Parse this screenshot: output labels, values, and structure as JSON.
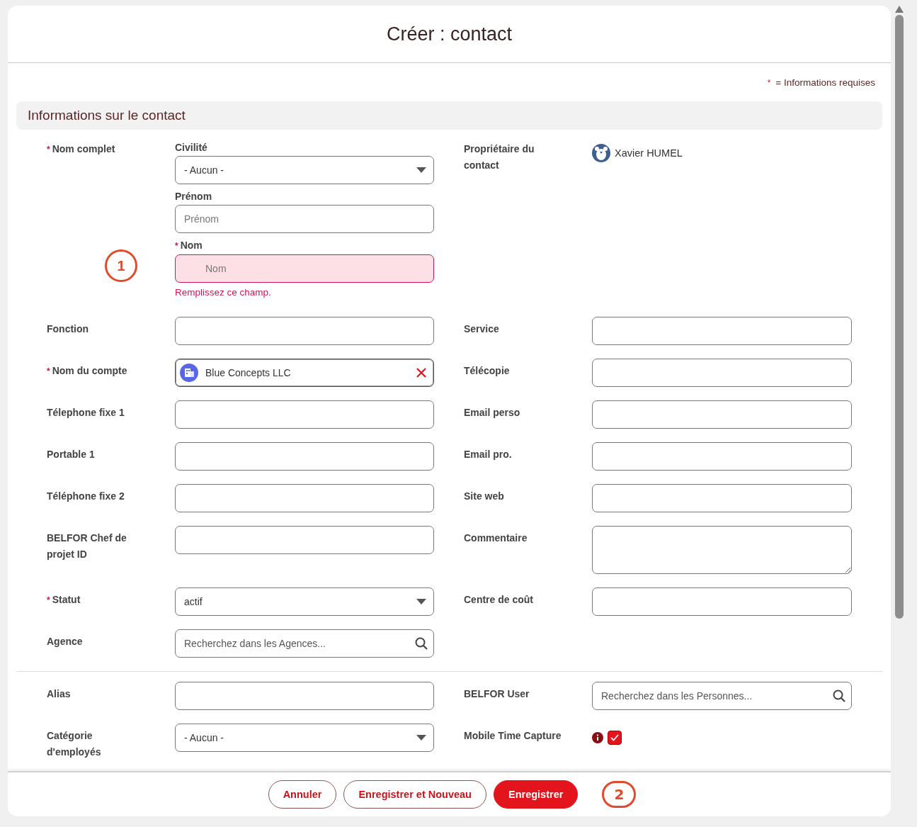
{
  "title": "Créer : contact",
  "required_note": {
    "mark": "*",
    "text": "= Informations requises"
  },
  "section": "Informations sur le contact",
  "name_group": {
    "label": "Nom complet",
    "required": true,
    "annotation": "1",
    "fields": [
      {
        "kind": "select",
        "label": "Civilité",
        "required": false,
        "value": "- Aucun -"
      },
      {
        "kind": "text",
        "label": "Prénom",
        "required": false,
        "placeholder": "Prénom",
        "invalid": false
      },
      {
        "kind": "text",
        "label": "Nom",
        "required": true,
        "placeholder": "Nom",
        "invalid": true,
        "error": "Remplissez ce champ."
      }
    ]
  },
  "owner": {
    "label": "Propriétaire du contact",
    "value": "Xavier HUMEL"
  },
  "rows": [
    [
      {
        "kind": "text",
        "label": "Fonction",
        "required": false
      },
      {
        "kind": "text",
        "label": "Service",
        "required": false
      }
    ],
    [
      {
        "kind": "lookup",
        "label": "Nom du compte",
        "required": true,
        "value": "Blue Concepts LLC"
      },
      {
        "kind": "text",
        "label": "Télécopie",
        "required": false
      }
    ],
    [
      {
        "kind": "text",
        "label": "Télephone fixe 1",
        "required": false
      },
      {
        "kind": "text",
        "label": "Email perso",
        "required": false
      }
    ],
    [
      {
        "kind": "text",
        "label": "Portable 1",
        "required": false
      },
      {
        "kind": "text",
        "label": "Email pro.",
        "required": false
      }
    ],
    [
      {
        "kind": "text",
        "label": "Téléphone fixe 2",
        "required": false
      },
      {
        "kind": "text",
        "label": "Site web",
        "required": false
      }
    ],
    [
      {
        "kind": "text",
        "label": "BELFOR Chef de projet ID",
        "required": false
      },
      {
        "kind": "textarea",
        "label": "Commentaire",
        "required": false
      }
    ],
    [
      {
        "kind": "select",
        "label": "Statut",
        "required": true,
        "value": "actif"
      },
      {
        "kind": "text",
        "label": "Centre de coût",
        "required": false
      }
    ],
    [
      {
        "kind": "search",
        "label": "Agence",
        "required": false,
        "placeholder": "Recherchez dans les Agences..."
      },
      null
    ]
  ],
  "rows2": [
    [
      {
        "kind": "text",
        "label": "Alias",
        "required": false
      },
      {
        "kind": "search",
        "label": "BELFOR User",
        "required": false,
        "placeholder": "Recherchez dans les Personnes..."
      }
    ],
    [
      {
        "kind": "select",
        "label": "Catégorie d'employés",
        "required": false,
        "value": "- Aucun -"
      },
      {
        "kind": "checkbox",
        "label": "Mobile Time Capture",
        "required": false,
        "checked": true,
        "info": true
      }
    ]
  ],
  "buttons": [
    {
      "kind": "secondary",
      "label": "Annuler"
    },
    {
      "kind": "secondary",
      "label": "Enregistrer et Nouveau"
    },
    {
      "kind": "primary",
      "label": "Enregistrer"
    }
  ],
  "footer_annotation": "2"
}
